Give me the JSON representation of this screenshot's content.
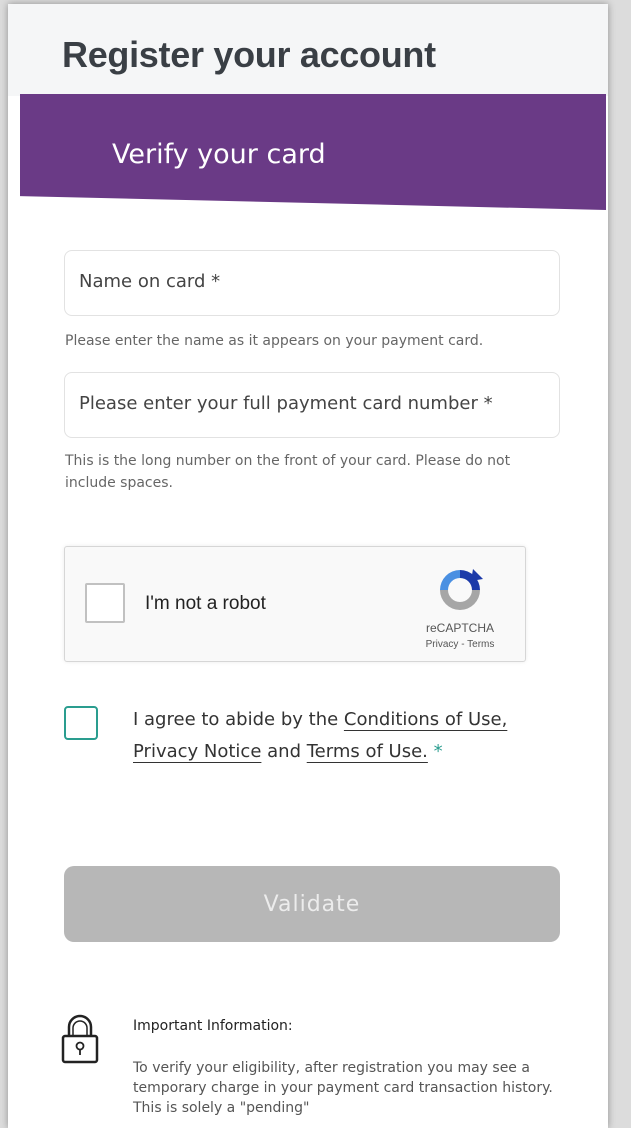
{
  "page": {
    "title": "Register your account",
    "banner_title": "Verify your card"
  },
  "form": {
    "name_field": {
      "placeholder": "Name on card *",
      "hint": "Please enter the name as it appears on your payment card."
    },
    "card_field": {
      "placeholder": "Please enter your full payment card number *",
      "hint": "This is the long number on the front of your card. Please do not include spaces."
    },
    "recaptcha": {
      "label": "I'm not a robot",
      "brand": "reCAPTCHA",
      "links": "Privacy - Terms"
    },
    "agree": {
      "prefix": "I agree to abide by the ",
      "conditions_link": "Conditions of Use,",
      "privacy_link": "Privacy Notice",
      "and": " and ",
      "terms_link": "Terms of Use.",
      "required_mark": " *"
    },
    "validate_label": "Validate"
  },
  "info": {
    "title": "Important Information:",
    "body": "To verify your eligibility, after registration you may see a temporary charge in your payment card transaction history. This is solely a \"pending\""
  },
  "colors": {
    "banner": "#6a3a86",
    "checkbox_accent": "#2a9d8f",
    "button_disabled": "#b7b7b7"
  },
  "icons": [
    "recaptcha-icon",
    "lock-icon"
  ]
}
